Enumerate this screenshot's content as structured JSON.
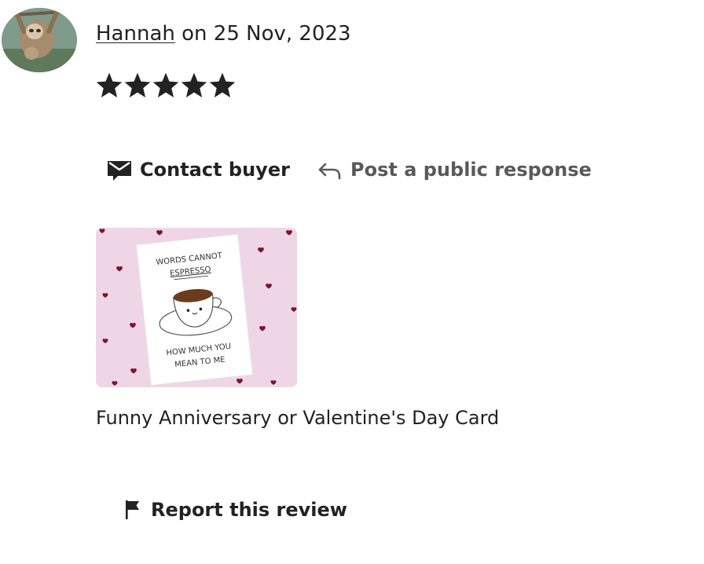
{
  "review": {
    "reviewer_name": "Hannah",
    "date_text": "on 25 Nov, 2023",
    "rating": 5,
    "rating_max": 5
  },
  "actions": {
    "contact_buyer_label": "Contact buyer",
    "public_response_label": "Post a public response",
    "report_label": "Report this review"
  },
  "product": {
    "title": "Funny Anniversary or Valentine's Day Card",
    "card_text_top_line1": "WORDS CANNOT",
    "card_text_top_line2": "ESPRESSO",
    "card_text_bottom_line1": "HOW MUCH YOU",
    "card_text_bottom_line2": "MEAN TO ME"
  },
  "colors": {
    "text_primary": "#222222",
    "text_secondary": "#595959",
    "thumb_background": "#efd6e6",
    "heart": "#7a1430"
  },
  "icons": {
    "avatar": "sloth-avatar",
    "star": "star-icon",
    "contact": "envelope-icon",
    "reply": "reply-arrow-icon",
    "report": "flag-icon"
  }
}
